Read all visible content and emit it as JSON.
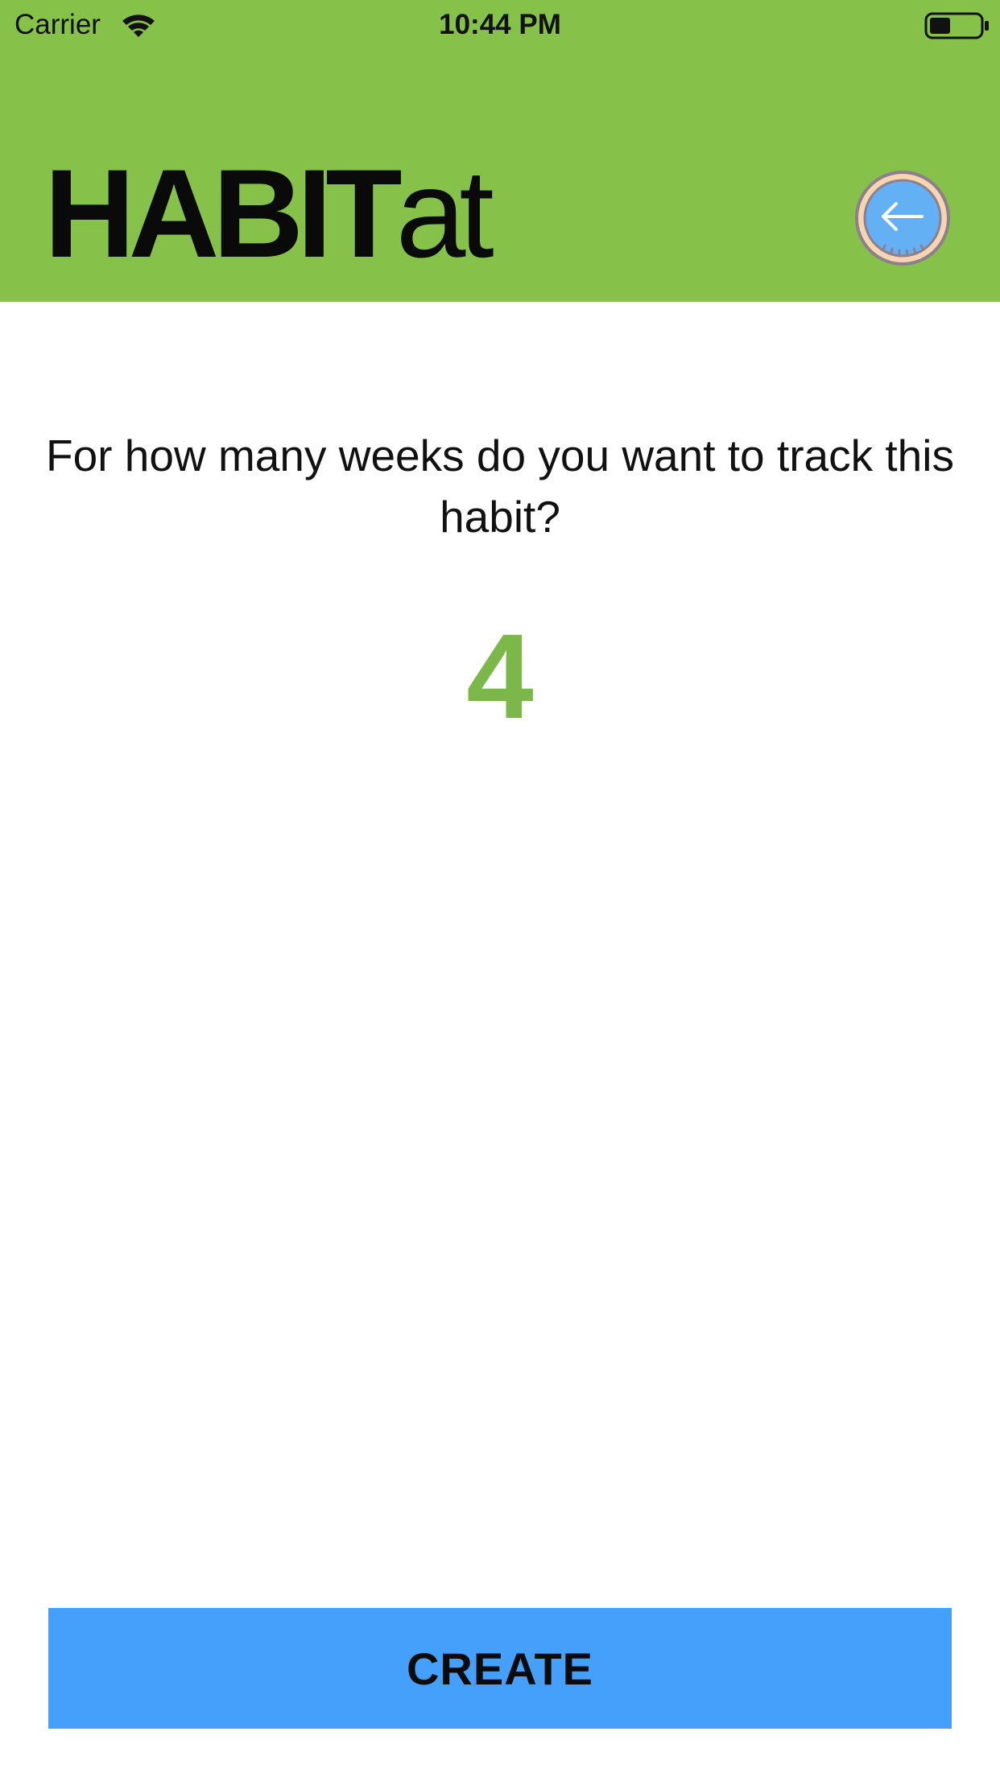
{
  "status_bar": {
    "carrier": "Carrier",
    "time": "10:44 PM",
    "wifi_icon": "wifi-icon",
    "battery_icon": "battery-icon"
  },
  "header": {
    "brand_strong": "HABIT",
    "brand_light": "at",
    "back_icon": "back-arrow-icon",
    "background_color": "#86c14a"
  },
  "main": {
    "question": "For how many weeks do you want to track this habit?",
    "weeks_value": "4",
    "value_color": "#7cb74a"
  },
  "footer": {
    "create_label": "CREATE",
    "button_color": "#45a0fb"
  }
}
